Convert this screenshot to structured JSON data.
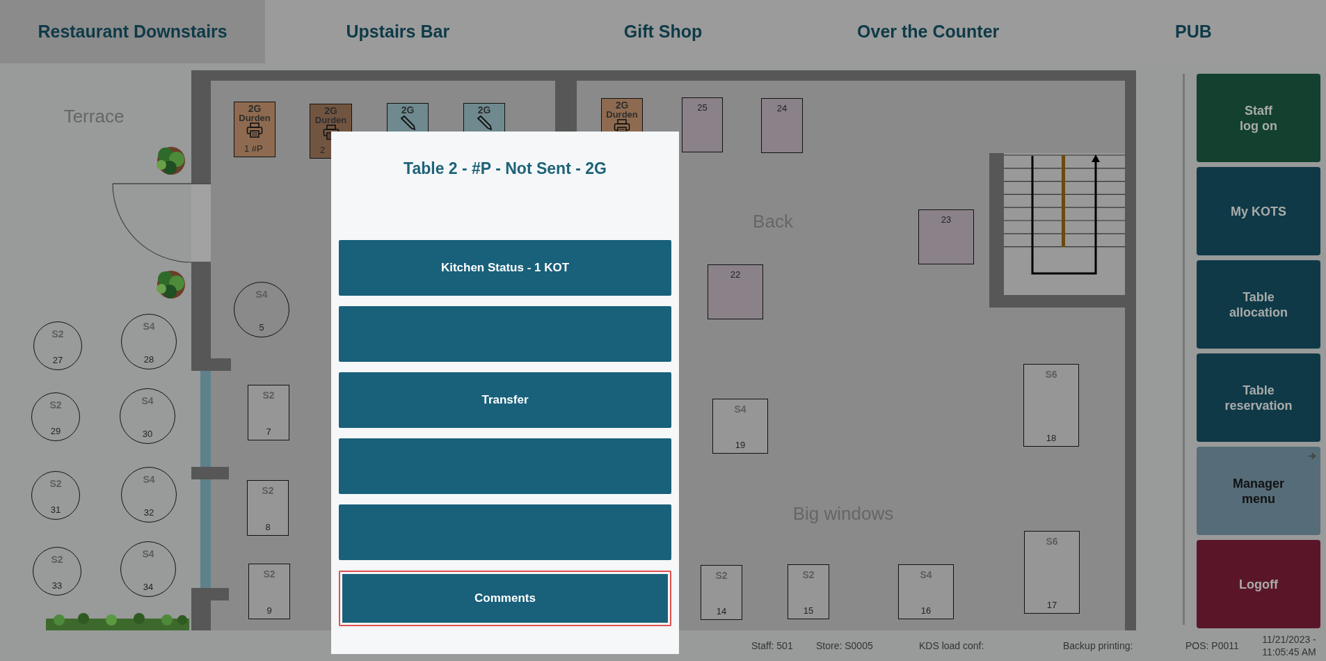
{
  "tabs": [
    {
      "label": "Restaurant Downstairs",
      "selected": true
    },
    {
      "label": "Upstairs Bar",
      "selected": false
    },
    {
      "label": "Gift Shop",
      "selected": false
    },
    {
      "label": "Over the Counter",
      "selected": false
    },
    {
      "label": "PUB",
      "selected": false
    }
  ],
  "floor": {
    "areas": [
      {
        "label": "Terrace"
      },
      {
        "label": "Back"
      },
      {
        "label": "Big windows"
      }
    ],
    "tables": [
      {
        "kind": "printer",
        "color": "#8e6b50",
        "group": "2G",
        "name": "Durden",
        "number": "1 #P"
      },
      {
        "kind": "printer",
        "color": "#725541",
        "group": "2G",
        "name": "Durden",
        "number": "2"
      },
      {
        "kind": "pencil",
        "color": "#6f8a8e",
        "group": "2G"
      },
      {
        "kind": "pencil",
        "color": "#6f8a8e",
        "group": "2G"
      },
      {
        "kind": "printer",
        "color": "#8e6b50",
        "group": "2G",
        "name": "Durden"
      },
      {
        "kind": "rect",
        "color": "#8a8189",
        "number": "25"
      },
      {
        "kind": "rect",
        "color": "#8a8189",
        "number": "24"
      },
      {
        "kind": "rect",
        "color": "#8a8189",
        "number": "23"
      },
      {
        "kind": "rect",
        "color": "#8a8189",
        "number": "22"
      },
      {
        "kind": "circle",
        "seats": "S4",
        "number": "5"
      },
      {
        "kind": "circle",
        "seats": "S2",
        "number": "27"
      },
      {
        "kind": "circle",
        "seats": "S4",
        "number": "28"
      },
      {
        "kind": "circle",
        "seats": "S2",
        "number": "29"
      },
      {
        "kind": "circle",
        "seats": "S4",
        "number": "30"
      },
      {
        "kind": "circle",
        "seats": "S2",
        "number": "31"
      },
      {
        "kind": "circle",
        "seats": "S4",
        "number": "32"
      },
      {
        "kind": "circle",
        "seats": "S2",
        "number": "33"
      },
      {
        "kind": "circle",
        "seats": "S4",
        "number": "34"
      },
      {
        "kind": "rect",
        "color": "#969696",
        "seats": "S2",
        "number": "7"
      },
      {
        "kind": "rect",
        "color": "#969696",
        "seats": "S2",
        "number": "8"
      },
      {
        "kind": "rect",
        "color": "#969696",
        "seats": "S2",
        "number": "9"
      },
      {
        "kind": "rect",
        "color": "#969696",
        "seats": "S4",
        "number": "19"
      },
      {
        "kind": "rect",
        "color": "#969696",
        "seats": "S6",
        "number": "18"
      },
      {
        "kind": "rect",
        "color": "#969696",
        "seats": "S6",
        "number": "17"
      },
      {
        "kind": "rect",
        "color": "#969696",
        "seats": "S2",
        "number": "14"
      },
      {
        "kind": "rect",
        "color": "#969696",
        "seats": "S2",
        "number": "15"
      },
      {
        "kind": "rect",
        "color": "#969696",
        "seats": "S4",
        "number": "16"
      }
    ]
  },
  "sidebar": [
    {
      "label": "Staff\nlog on",
      "color": "#13402f",
      "submenu": false
    },
    {
      "label": "My KOTS",
      "color": "#0f3947",
      "submenu": false
    },
    {
      "label": "Table\nallocation",
      "color": "#0f3947",
      "submenu": false
    },
    {
      "label": "Table\nreservation",
      "color": "#0f3947",
      "submenu": false
    },
    {
      "label": "Manager\nmenu",
      "color": "#566d79",
      "submenu": true
    },
    {
      "label": "Logoff",
      "color": "#5a1628",
      "submenu": false
    }
  ],
  "status_bar": [
    "Staff: 501",
    "Store: S0005",
    "KDS load conf:",
    "Backup printing:",
    "POS: P0011",
    "11/21/2023 -\n11:05:45 AM"
  ],
  "dialog": {
    "title": "Table 2 - #P - Not Sent - 2G",
    "actions": [
      {
        "label": "Kitchen Status - 1 KOT",
        "selected": false
      },
      {
        "selected": false
      },
      {
        "label": "Transfer",
        "selected": false
      },
      {
        "selected": false
      },
      {
        "selected": false
      },
      {
        "label": "Comments",
        "selected": true
      }
    ]
  }
}
